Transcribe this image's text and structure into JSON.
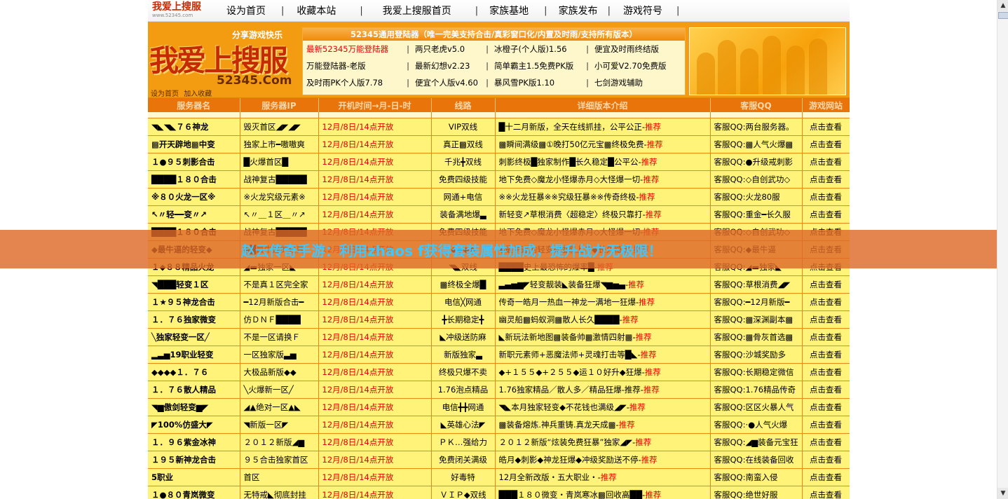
{
  "nav": {
    "logo_text": "我爱上搜服",
    "logo_sub": "www.52345.com",
    "links": [
      "设为首页",
      "收藏本站",
      "我爱上搜服首页",
      "家族基地",
      "家族发布",
      "游戏符号"
    ]
  },
  "banner": {
    "share": "分享游戏快乐",
    "logo": "我爱上搜服",
    "domain": "52345.Com",
    "small_links": [
      "设为首页",
      "加入收藏"
    ],
    "center_title": "52345通用登陆器（唯一完美支持合击/真彩窗口化/内置及时雨/支持所有版本）",
    "center_rows": [
      [
        {
          "t": "最新52345万能登陆器",
          "red": true
        },
        {
          "t": "两只老虎v5.0"
        },
        {
          "t": "冰橙子(个人版)1.56"
        },
        {
          "t": "便宜及时雨终结版"
        }
      ],
      [
        {
          "t": "万能登陆器-老版"
        },
        {
          "t": "最新幻想v2.23"
        },
        {
          "t": "简单霸主1.5免费PK版"
        },
        {
          "t": "小可爱V2.70免费版"
        }
      ],
      [
        {
          "t": "及时雨PK个人版7.78"
        },
        {
          "t": "便宜个人版v4.60"
        },
        {
          "t": "暴风雪PK版1.10"
        },
        {
          "t": "七剑游戏辅助"
        }
      ]
    ]
  },
  "table": {
    "headers": [
      "服务器名",
      "服务器IP",
      "开机时间→月-日-时",
      "线路",
      "详细版本介绍",
      "客服QQ",
      "游戏网站"
    ],
    "rows": [
      [
        "◥◣◥◣７６神龙",
        "毁灭首区◢◤◢◤",
        "12月/8日/14点开放",
        "VIP双线",
        "█十二月新版，全天在线抓挂，公平公正-",
        "推荐",
        "客服QQ:两台服务器。",
        "点击查看"
      ],
      [
        "▩开天辟地▩中变",
        "独家上市━嗷嗷爽",
        "12月/8日/14点开放",
        "真正▩双线",
        "▩瞬间满级▩①晚打50亿元宝▩终极免费-",
        "推荐",
        "客服QQ:▩人气火爆▩",
        "点击查看"
      ],
      [
        "１●９５刺影合击",
        "█火爆首区█",
        "12月/8日/14点开放",
        "千兆╋双线",
        "刺影终极█独家制作█长久稳定█公平公-",
        "推荐",
        "客服QQ:●升级戒刺影",
        "点击查看"
      ],
      [
        "████１８０合击",
        "战神复古█████",
        "12月/8日/14点开放",
        "免费四级技能",
        "地下免费◇魔龙小怪爆赤月◇大怪爆一切-",
        "推荐",
        "客服QQ:◇自创武功◇",
        "点击查看"
      ],
      [
        "※８０火龙一区※",
        "※火龙究级元素※",
        "12月/8日/14点开放",
        "网通+电信",
        "※※火龙狂暴※※究级狂暴※※传奇终极-",
        "推荐",
        "客服QQ:火龙80服",
        "点击查看"
      ],
      [
        "↖〃轻━━变〃↗",
        "↖〃＿１区＿〃↗",
        "12月/8日/14点开放",
        "装备满地爆▃",
        "新轻变↗草根消费〈超稳定〉终极只靠打-",
        "推荐",
        "客服QQ:重金━长久服",
        "点击查看"
      ],
      [
        "████１８０合击",
        "战神复古█████",
        "12月/8日/14点开放",
        "免费四级技能",
        "地下免费◇魔龙小怪爆赤月◇大怪爆一切-",
        "推荐",
        "客服QQ:◇自创武功◇",
        "点击查看"
      ],
      [
        "◆最牛逼的轻变◆",
        "◆█最牛逼的轻变",
        "12月/8日/14点开放",
        "◆◆◆◆",
        "◆最牛逼的轻变◆独家上市◆长久稳定-",
        "推荐",
        "客服QQ:◆最牛逼",
        "点击查看"
      ],
      [
        "１◆８８精品火龙",
        "◢▬独家一区◣",
        "12月/8日/14点开放",
        "◥◣双线",
        "████史上最恐怖的爆率█-",
        "推荐",
        "客服QQ:◢▬独家◣",
        "点击查看"
      ],
      [
        "◥███轻变１区",
        "不是真１区完全家",
        "12月/8日/14点开放",
        "▩终极全爆█",
        "▃▄▅▆◤轻变靓装◣装备狂爆◥▆▅▄-",
        "推荐",
        "客服QQ:草根消费◢◤",
        "点击查看"
      ],
      [
        "１★９５神龙合击",
        "━12月新版合击━",
        "12月/8日/14点开放",
        "电信╳网通",
        "传奇一皓月一热血一神龙一满地一狂爆-",
        "推荐",
        "客服QQ:━12月新版━",
        "点击查看"
      ],
      [
        "１．７６独家微变",
        "仿ＤＮＦ████",
        "12月/8日/14点开放",
        "╋长期稳定╋",
        "幽灵船▩蚂蚁洞▩散人长久████-",
        "推荐",
        "客服QQ:▩深渊副本▩",
        "点击查看"
      ],
      [
        "╲独家轻变一区╱",
        "不是一区请换Ｆ",
        "12月/8日/14点开放",
        "◣冲级送防麻",
        "◣新玩法新地图▩装备帅▩激情四射▩-",
        "推荐",
        "客服QQ:▩骨灰首选▩",
        "点击查看"
      ],
      [
        "▂▃▅19职业轻变",
        "一区独家版▃▅",
        "12月/8日/14点开放",
        "新版独家▃",
        "新职元素师+恶魔法师+灵魂打击等█◣-",
        "推荐",
        "客服QQ:沙城奖励多",
        "点击查看"
      ],
      [
        "◆◆◆◆１．７６",
        "大极品新版◆◆",
        "12月/8日/14点开放",
        "终极只爆不卖",
        "◆+１５５◆+２５５◆运１０好升◆狂爆-",
        "推荐",
        "客服QQ:长期稳定微信",
        "点击查看"
      ],
      [
        "１．７６散人精品",
        "╲火爆新一区╱",
        "12月/8日/14点开放",
        "1.76泡点精品",
        "1.76独家精品／散人多／精品狂爆-推荐-",
        "推荐",
        "客服QQ:1.76精品传奇",
        "点击查看"
      ],
      [
        "◥▆傲剑轻变▆◤",
        "◢▲绝对一区▲◣",
        "12月/8日/14点开放",
        "电信╋╋网通",
        "◥◣本月独家轻变◆不花钱也满级◢◤-",
        "推荐",
        "客服QQ:区区火暴人气",
        "点击查看"
      ],
      [
        "◤100%仿盛大◤",
        "◥新版一区◤",
        "12月/8日/14点开放",
        "◣英雄心法◤",
        "▩装备熔炼.神兵重铸.真龙天成▩-",
        "推荐",
        "客服QQ:·●人气火爆",
        "点击查看"
      ],
      [
        "１．９６紫金冰神",
        "２０１２新版◢▆",
        "12月/8日/14点开放",
        "ＰＫ…强给力",
        "２０１２新版“炫装免费狂暴”独家◢◤-",
        "推荐",
        "客服QQ:◢▆装备元宝狂",
        "点击查看"
      ],
      [
        "１９５新神龙合击",
        "９５合击独家首区",
        "12月/8日/14点开放",
        "免费闭关满级",
        "皓月◆刺影◆神龙狂爆◆冲级奖励送不停-",
        "推荐",
        "客服QQ:在线装备回收",
        "点击查看"
      ],
      [
        "5职业",
        "首区",
        "12月/8日/14点开放",
        "好毒特",
        "12月全新改版・五大职业・-",
        "推荐",
        "客服QQ:南蛮入侵",
        "点击查看"
      ],
      [
        "１●８０青岚微变",
        "无特戒◣彻底封挂",
        "12月/8日/14点开放",
        "ＶＩＰ◆双线",
        "███１８０微变・青岚寒冰▩回收高██-",
        "推荐",
        "客服QQ:绝世好服",
        "点击查看"
      ]
    ]
  },
  "overlay": {
    "text": "赵云传奇手游：利用zhaos f获得套装属性加成，提升战力无极限！"
  },
  "colors": {
    "header_bg": "#e8740a",
    "row_bg": "#fff37a",
    "red": "#e60000",
    "overlay_text": "#3ec7ff"
  }
}
